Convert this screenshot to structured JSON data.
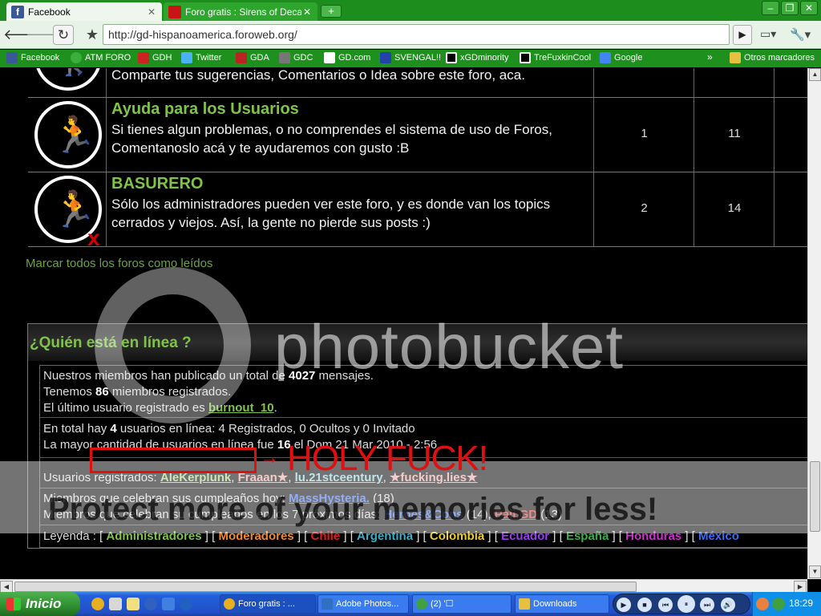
{
  "browser": {
    "tabs": [
      {
        "title": "Facebook",
        "favicon": "facebook-favicon",
        "active": true
      },
      {
        "title": "Foro gratis : Sirens of Decay",
        "favicon": "forum-favicon",
        "active": false
      }
    ],
    "new_tab_icon": "+",
    "window_buttons": {
      "minimize": "–",
      "maximize": "❐",
      "close": "✕"
    },
    "url": "http://gd-hispanoamerica.foroweb.org/",
    "bookmarks": [
      {
        "label": "Facebook",
        "color": "#3b5998"
      },
      {
        "label": "ATM FORO",
        "color": "#3ab03a"
      },
      {
        "label": "GDH",
        "color": "#cc2222"
      },
      {
        "label": "Twitter",
        "color": "#4ab3f4"
      },
      {
        "label": "GDA",
        "color": "#bb2222"
      },
      {
        "label": "GDC",
        "color": "#777777"
      },
      {
        "label": "GD.com",
        "color": "#ffffff"
      },
      {
        "label": "SVENGAL!!",
        "color": "#2244aa"
      },
      {
        "label": "xGDminority",
        "color": "#000000"
      },
      {
        "label": "TreFuxkinCool",
        "color": "#000000"
      },
      {
        "label": "Google",
        "color": "#4285f4"
      }
    ],
    "bookmarks_more": "»",
    "other_bookmarks": "Otros marcadores"
  },
  "forum": {
    "rows": [
      {
        "title": "",
        "description": "Comparte tus sugerencias, Comentarios o Idea sobre este foro, aca.",
        "topics": "",
        "posts": ""
      },
      {
        "title": "Ayuda para los Usuarios",
        "description": "Si tienes algun problemas, o no comprendes el sistema de uso de Foros, Comentanoslo acá y te ayudaremos con gusto :B",
        "topics": "1",
        "posts": "11"
      },
      {
        "title": "BASURERO",
        "description": "Sólo los administradores pueden ver este foro, y es donde van los topics cerrados y viejos. Así, la gente no pierde sus posts :)",
        "topics": "2",
        "posts": "14"
      }
    ],
    "mark_read": "Marcar todos los foros como leídos"
  },
  "who_online": {
    "title": "¿Quién está en línea ?",
    "posts_prefix": "Nuestros miembros han publicado un total de ",
    "posts_count": "4027",
    "posts_suffix": " mensajes.",
    "members_prefix": "Tenemos ",
    "members_count": "86",
    "members_suffix": " miembros registrados.",
    "last_user_prefix": "El último usuario registrado es ",
    "last_user": "burnout_10",
    "last_user_suffix": ".",
    "online_prefix": "En total hay ",
    "online_count": "4",
    "online_suffix": " usuarios en línea: 4 Registrados, 0 Ocultos y 0 Invitado",
    "max_prefix": "La mayor cantidad de usuarios en línea fue ",
    "max_count": "16",
    "max_suffix": " el Dom 21 Mar 2010 - 2:56",
    "registered_label": "Usuarios registrados: ",
    "registered_users": [
      {
        "name": "AleKerplunk",
        "color": "#a6d17a"
      },
      {
        "name": "Fraaan★",
        "color": "#f0a0a0"
      },
      {
        "name": "lu.21stceentury",
        "color": "#8fd0d8"
      },
      {
        "name": "★fucking.lies★",
        "color": "#f0a0a0"
      }
    ],
    "birthdays_today_label": "Miembros que celebran sus cumpleaños hoy: ",
    "birthdays_today_user": "MassHysteria.",
    "birthdays_today_age": " (18)",
    "birthdays_week_label": "Miembros que celebran su cumpleaños en los 7 próximos días: ",
    "birthdays_week": [
      {
        "name": "Heroes&Cons",
        "age": " (14), ",
        "color": "#3a6cf5"
      },
      {
        "name": "Paii.GD",
        "age": " (13)",
        "color": "#e03030"
      }
    ],
    "legend_label": "Leyenda :",
    "legend": [
      {
        "name": "Administradores",
        "color": "#7fc347"
      },
      {
        "name": "Moderadores",
        "color": "#f08a30"
      },
      {
        "name": "Chile",
        "color": "#e02020"
      },
      {
        "name": "Argentina",
        "color": "#3ab0c8"
      },
      {
        "name": "Colombia",
        "color": "#f0d020"
      },
      {
        "name": "Ecuador",
        "color": "#9b3df0"
      },
      {
        "name": "España",
        "color": "#3ab04a"
      },
      {
        "name": "Honduras",
        "color": "#d030d0"
      },
      {
        "name": "México",
        "color": "#3a6cf5"
      }
    ]
  },
  "watermark": {
    "logo_text": "photobucket",
    "protect_text": "Protect more of your memories for less!",
    "annotation": "HOLY FUCK!",
    "annotation_arrow": "→"
  },
  "scrollbars": {
    "up": "▲",
    "down": "▼",
    "left": "◀",
    "right": "▶"
  },
  "taskbar": {
    "start_label": "Inicio",
    "tasks": [
      {
        "label": "Foro gratis : ...",
        "color": "#e8b020",
        "active": true
      },
      {
        "label": "Adobe Photos...",
        "color": "#3070c0",
        "active": false
      },
      {
        "label": "(2) '☐",
        "color": "#40a040",
        "active": false
      },
      {
        "label": "Downloads",
        "color": "#e8c040",
        "active": false
      }
    ],
    "media_buttons": [
      "▶",
      "■",
      "⏮",
      "⏸",
      "⏭",
      "🔊"
    ],
    "clock": "18:29",
    "colors": {
      "bar": "#245edb",
      "start": "#2f8f2f",
      "tray": "#0f8fe8"
    }
  }
}
